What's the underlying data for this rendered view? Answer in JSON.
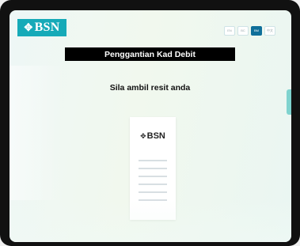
{
  "brand": {
    "logo_text": "BSN",
    "logo_color": "#16aab8"
  },
  "header": {
    "languages": [
      {
        "label": "EN",
        "active": false
      },
      {
        "label": "BC",
        "active": false
      },
      {
        "label": "BM",
        "active": true
      },
      {
        "label": "中文",
        "active": false
      }
    ]
  },
  "main": {
    "title": "Penggantian Kad Debit",
    "instruction": "Sila ambil resit anda"
  },
  "receipt": {
    "logo_text": "BSN",
    "line_count": 6
  }
}
